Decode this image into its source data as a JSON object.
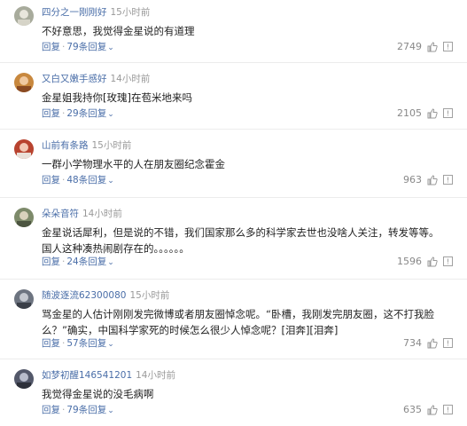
{
  "comments": [
    {
      "user": "四分之一刚刚好",
      "time": "15小时前",
      "text": "不好意思，我觉得金星说的有道理",
      "reply_label": "回复",
      "replies": "79条回复",
      "likes": "2749",
      "avatar_color": "#a8ab9c"
    },
    {
      "user": "又白又嫩手感好",
      "time": "14小时前",
      "text": "金星姐我持你[玫瑰]在苞米地来吗",
      "reply_label": "回复",
      "replies": "29条回复",
      "likes": "2105",
      "avatar_color": "#c8883e"
    },
    {
      "user": "山前有条路",
      "time": "15小时前",
      "text": "一群小学物理水平的人在朋友圈纪念霍金",
      "reply_label": "回复",
      "replies": "48条回复",
      "likes": "963",
      "avatar_color": "#b8432f"
    },
    {
      "user": "朵朵音符",
      "time": "14小时前",
      "text": "金星说话犀利，但是说的不错，我们国家那么多的科学家去世也没啥人关注，转发等等。国人这种凑热闹剧存在的。。。。。。",
      "reply_label": "回复",
      "replies": "24条回复",
      "likes": "1596",
      "avatar_color": "#7d8a6a"
    },
    {
      "user": "随波逐流62300080",
      "time": "15小时前",
      "text": "骂金星的人估计刚刚发完微博或者朋友圈悼念呢。“卧槽，我刚发完朋友圈，这不打我脸么？”确实，中国科学家死的时候怎么很少人悼念呢？[泪奔][泪奔]",
      "reply_label": "回复",
      "replies": "57条回复",
      "likes": "734",
      "avatar_color": "#6d7480"
    },
    {
      "user": "如梦初醒146541201",
      "time": "14小时前",
      "text": "我觉得金星说的没毛病啊",
      "reply_label": "回复",
      "replies": "79条回复",
      "likes": "635",
      "avatar_color": "#53586a"
    }
  ],
  "separator": "·"
}
